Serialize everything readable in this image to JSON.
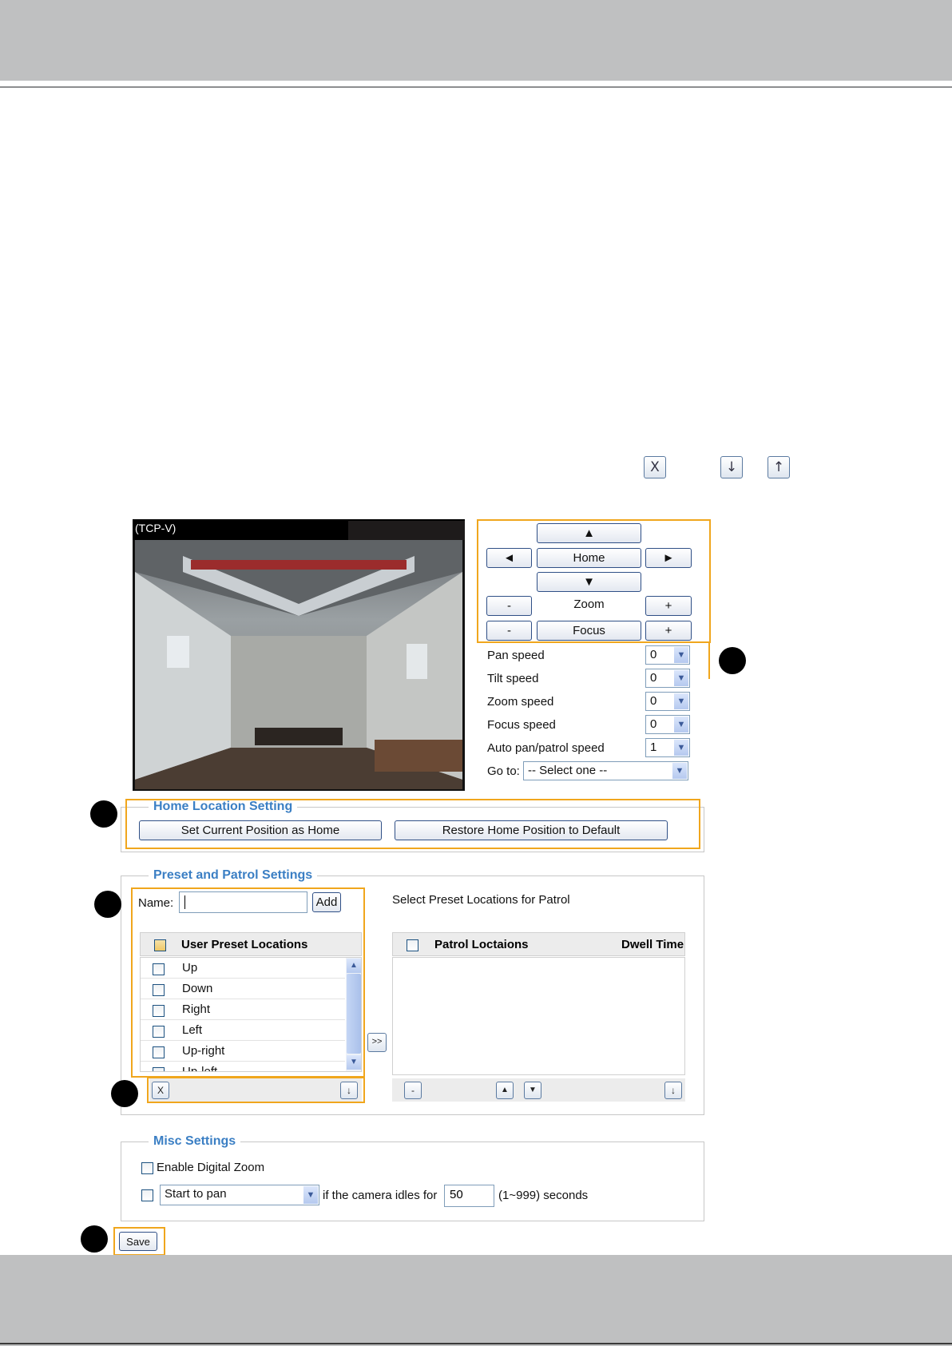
{
  "toolbar_icons": {
    "delete": "X",
    "move_down": "↓",
    "move_up": "↑"
  },
  "video": {
    "title": "(TCP-V)"
  },
  "ptz": {
    "up": "▲",
    "left": "◄",
    "home": "Home",
    "right": "►",
    "down": "▼",
    "zoom_minus": "-",
    "zoom_label": "Zoom",
    "zoom_plus": "+",
    "focus_minus": "-",
    "focus_label": "Focus",
    "focus_plus": "+"
  },
  "speeds": [
    {
      "label": "Pan speed",
      "value": "0"
    },
    {
      "label": "Tilt speed",
      "value": "0"
    },
    {
      "label": "Zoom speed",
      "value": "0"
    },
    {
      "label": "Focus speed",
      "value": "0"
    },
    {
      "label": "Auto pan/patrol speed",
      "value": "1"
    }
  ],
  "goto": {
    "label": "Go to:",
    "value": "-- Select one --"
  },
  "home_location": {
    "title": "Home Location Setting",
    "set_button": "Set Current Position as Home",
    "restore_button": "Restore Home Position to Default"
  },
  "preset": {
    "title": "Preset and Patrol Settings",
    "name_label": "Name:",
    "name_value": "",
    "add_button": "Add",
    "select_label": "Select Preset Locations for Patrol",
    "user_header": "User Preset Locations",
    "items": [
      "Up",
      "Down",
      "Right",
      "Left",
      "Up-right",
      "Up-left"
    ],
    "transfer_button": ">>",
    "patrol_header": "Patrol Loctaions",
    "dwell_header": "Dwell Time",
    "user_delete": "X",
    "user_down": "↓",
    "patrol_remove": "-",
    "patrol_up": "▲",
    "patrol_down": "▼",
    "patrol_move": "↓"
  },
  "misc": {
    "title": "Misc Settings",
    "digital_zoom": "Enable Digital Zoom",
    "start_option": "Start to pan",
    "idle_text": "if the camera idles for",
    "idle_value": "50",
    "range_text": "(1~999) seconds"
  },
  "save_button": "Save"
}
